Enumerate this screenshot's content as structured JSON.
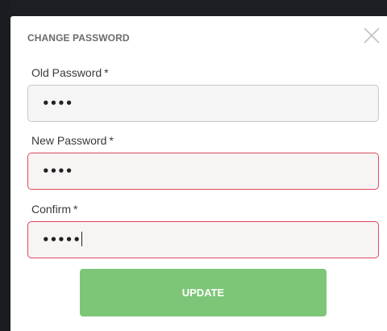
{
  "dialog": {
    "title": "CHANGE PASSWORD"
  },
  "fields": [
    {
      "label": "Old Password",
      "required_mark": "*",
      "value": "••••",
      "state": "normal"
    },
    {
      "label": "New Password",
      "required_mark": "*",
      "value": "••••",
      "state": "error"
    },
    {
      "label": "Confirm",
      "required_mark": "*",
      "value": "•••••",
      "state": "error",
      "focused": true
    }
  ],
  "actions": {
    "update_label": "UPDATE"
  },
  "colors": {
    "primary_button": "#7dc678",
    "error_border": "#e0495e",
    "input_background": "#f5f5f5",
    "title_text": "#6b6b6b"
  },
  "icons": {
    "close": "close-icon"
  }
}
